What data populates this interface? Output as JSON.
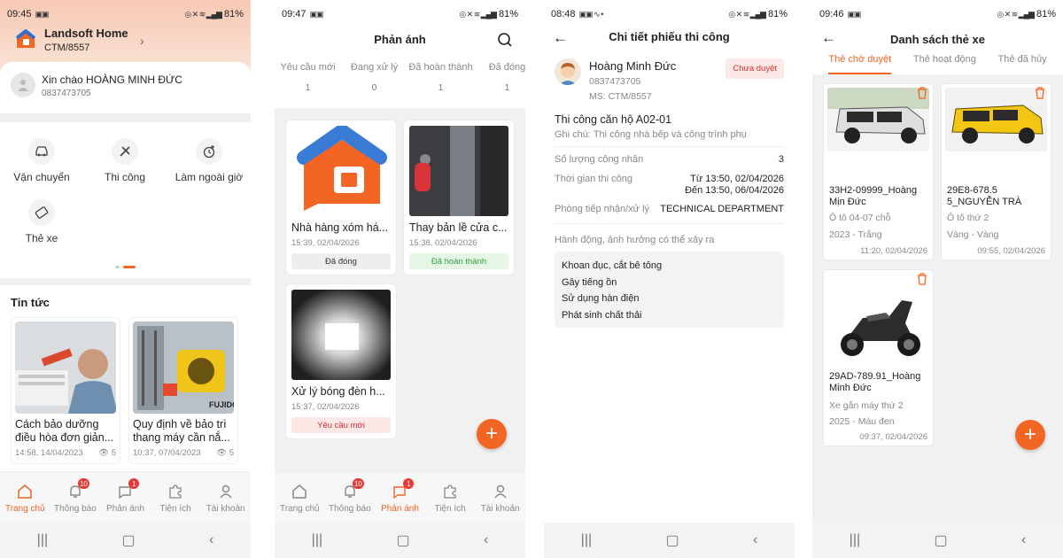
{
  "colors": {
    "accent": "#f26522",
    "danger": "#d32f2f",
    "success": "#2e9e3e"
  },
  "bottom_nav": [
    {
      "label": "Trang chủ",
      "icon": "home-icon",
      "badge": ""
    },
    {
      "label": "Thông báo",
      "icon": "bell-icon",
      "badge": "10"
    },
    {
      "label": "Phản ánh",
      "icon": "chat-icon",
      "badge": "1"
    },
    {
      "label": "Tiện ích",
      "icon": "puzzle-icon",
      "badge": ""
    },
    {
      "label": "Tài khoản",
      "icon": "user-icon",
      "badge": ""
    }
  ],
  "screen1": {
    "time": "09:45",
    "battery": "81%",
    "company": {
      "name": "Landsoft Home",
      "code": "CTM/8557"
    },
    "greeting": "Xin chào HOÀNG MINH ĐỨC",
    "phone": "0837473705",
    "menu": [
      {
        "label": "Vận chuyển",
        "icon": "car-icon"
      },
      {
        "label": "Thi công",
        "icon": "tools-icon"
      },
      {
        "label": "Làm ngoài giờ",
        "icon": "clock-plus-icon"
      },
      {
        "label": "Thẻ xe",
        "icon": "card-icon"
      }
    ],
    "news_title": "Tin tức",
    "news": [
      {
        "title": "Cách bảo dưỡng điều hòa đơn giản...",
        "date": "14:58, 14/04/2023",
        "views": "5"
      },
      {
        "title": "Quy định về bảo trì thang máy cần nắ...",
        "date": "10:37, 07/04/2023",
        "views": "5"
      }
    ]
  },
  "screen2": {
    "time": "09:47",
    "battery": "81%",
    "title": "Phản ánh",
    "tabs": [
      {
        "label": "Yêu cầu mới",
        "count": "1"
      },
      {
        "label": "Đang xử lý",
        "count": "0"
      },
      {
        "label": "Đã hoàn thành",
        "count": "1"
      },
      {
        "label": "Đã đóng",
        "count": "1"
      }
    ],
    "cards": [
      {
        "title": "Nhà hàng xóm há...",
        "date": "15:39, 02/04/2026",
        "status": "Đã đóng"
      },
      {
        "title": "Thay bản lề cửa c...",
        "date": "15:38, 02/04/2026",
        "status": "Đã hoàn thành"
      },
      {
        "title": "Xử lý bóng đèn h...",
        "date": "15:37, 02/04/2026",
        "status": "Yêu cầu mới"
      }
    ]
  },
  "screen3": {
    "time": "08:48",
    "battery": "81%",
    "title": "Chi tiết phiếu thi công",
    "name": "Hoàng Minh Đức",
    "phone": "0837473705",
    "ms": "MS: CTM/8557",
    "status": "Chưa duyệt",
    "job": "Thi công căn hộ A02-01",
    "note": "Ghi chú: Thi công nhà bếp và công trình phụ",
    "workers_label": "Số lượng công nhân",
    "workers_value": "3",
    "time_label": "Thời gian thi công",
    "time_from": "Từ 13:50, 02/04/2026",
    "time_to": "Đến 13:50, 06/04/2026",
    "dept_label": "Phòng tiếp nhận/xử lý",
    "dept_value": "TECHNICAL DEPARTMENT",
    "impact_label": "Hành động, ảnh hưởng có thể xảy ra",
    "impacts": [
      "Khoan đục, cắt bê tông",
      "Gây tiếng ồn",
      "Sử dụng hàn điện",
      "Phát sinh chất thải"
    ]
  },
  "screen4": {
    "time": "09:46",
    "battery": "81%",
    "title": "Danh sách thẻ xe",
    "tabs": [
      "Thẻ chờ duyệt",
      "Thẻ hoạt động",
      "Thẻ đã hủy"
    ],
    "cards": [
      {
        "plate": "33H2-09999_Hoàng Mịn Đức",
        "type": "Ô tô 04-07 chỗ",
        "detail": "2023 - Trắng",
        "date": "11:20, 02/04/2026"
      },
      {
        "plate": "29E8-678.5 5_NGUYỄN TRÀ",
        "type": "Ô tô thứ 2",
        "detail": "Vàng - Vàng",
        "date": "09:55, 02/04/2026"
      },
      {
        "plate": "29AD-789.91_Hoàng Minh Đức",
        "type": "Xe gắn máy thứ 2",
        "detail": "2025 - Màu đen",
        "date": "09:37, 02/04/2026"
      }
    ]
  }
}
